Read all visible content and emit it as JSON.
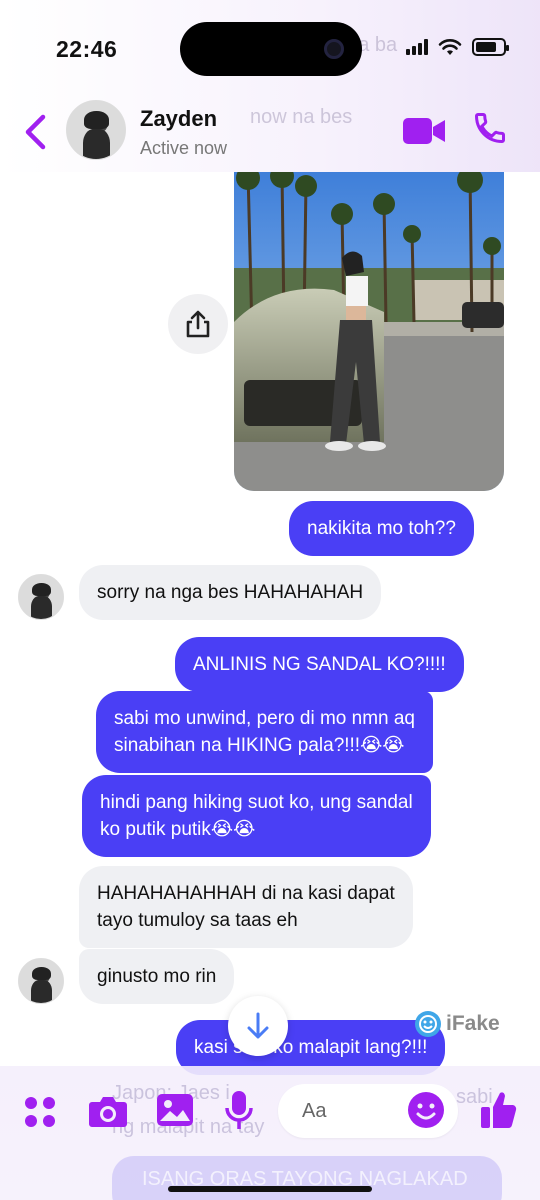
{
  "status_bar": {
    "time": "22:46",
    "battery_level": 0.75
  },
  "background_ghost": {
    "top_text_1": "nga ba",
    "top_text_2": "now na bes",
    "bottom_line_1": "Japon: Jaes i",
    "bottom_line_2": "ng malapit na tay",
    "bottom_line_3": "sabi",
    "bottom_line_4": "ISANG ORAS TAYONG NAGLAKAD"
  },
  "header": {
    "contact_name": "Zayden",
    "contact_status": "Active now"
  },
  "colors": {
    "accent": "#a020f0",
    "outgoing_bubble": "#4a3ff5",
    "incoming_bubble": "#eff0f3"
  },
  "messages": [
    {
      "direction": "out",
      "text": "nakikita mo toh??"
    },
    {
      "direction": "in",
      "text": "sorry na nga bes HAHAHAHAH"
    },
    {
      "direction": "out",
      "text": "ANLINIS NG SANDAL KO?!!!!"
    },
    {
      "direction": "out",
      "line1": "sabi mo unwind, pero di mo nmn aq",
      "line2": "sinabihan na HIKING pala?!!!😭😭"
    },
    {
      "direction": "out",
      "line1": "hindi pang hiking suot ko, ung sandal",
      "line2": "ko putik putik😭😭"
    },
    {
      "direction": "in",
      "line1": "HAHAHAHAHHAH di na kasi dapat",
      "line2": "tayo tumuloy sa taas eh"
    },
    {
      "direction": "in",
      "text": "ginusto mo rin"
    },
    {
      "direction": "out",
      "text": "kasi sabi ko malapit lang?!!!"
    }
  ],
  "composer": {
    "placeholder": "Aa"
  },
  "watermark": {
    "text": "iFake"
  },
  "icons": {
    "back": "chevron-left-icon",
    "video": "video-camera-icon",
    "call": "phone-icon",
    "share": "share-icon",
    "menu": "four-dots-icon",
    "camera": "camera-icon",
    "gallery": "image-icon",
    "mic": "microphone-icon",
    "emoji": "smiley-icon",
    "like": "thumbs-up-icon",
    "scroll": "arrow-down-icon"
  }
}
